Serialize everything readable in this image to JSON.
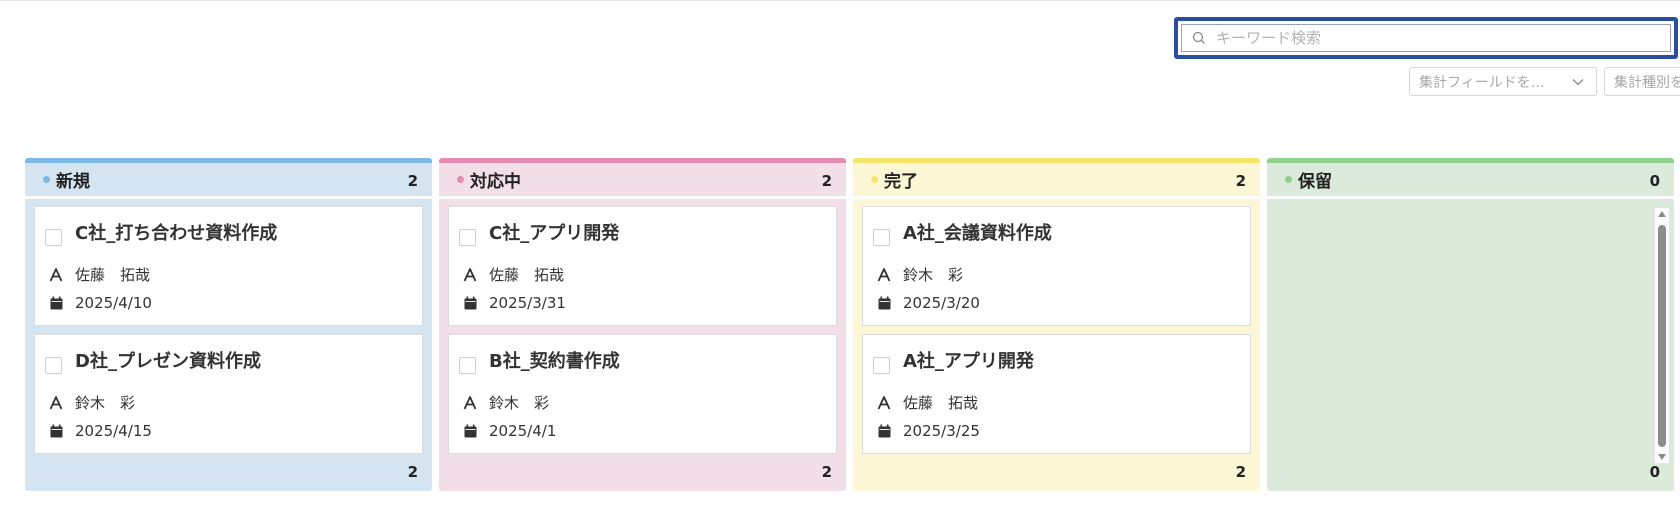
{
  "search": {
    "placeholder": "キーワード検索"
  },
  "aggregate": {
    "field_select": "集計フィールドを…",
    "type_select": "集計種別を"
  },
  "columns": [
    {
      "title": "新規",
      "count": "2",
      "footer_count": "2",
      "accent": "#7bb8e6",
      "header_bg": "#d4e4f0",
      "body_bg": "#d4e4f0",
      "cards": [
        {
          "title": "C社_打ち合わせ資料作成",
          "assignee": "佐藤　拓哉",
          "date": "2025/4/10"
        },
        {
          "title": "D社_プレゼン資料作成",
          "assignee": "鈴木　彩",
          "date": "2025/4/15"
        }
      ]
    },
    {
      "title": "対応中",
      "count": "2",
      "footer_count": "2",
      "accent": "#e58bb1",
      "header_bg": "#f3dfe7",
      "body_bg": "#f3dfe7",
      "cards": [
        {
          "title": "C社_アプリ開発",
          "assignee": "佐藤　拓哉",
          "date": "2025/3/31"
        },
        {
          "title": "B社_契約書作成",
          "assignee": "鈴木　彩",
          "date": "2025/4/1"
        }
      ]
    },
    {
      "title": "完了",
      "count": "2",
      "footer_count": "2",
      "accent": "#f5e56b",
      "header_bg": "#fdf7d6",
      "body_bg": "#fdf7d6",
      "cards": [
        {
          "title": "A社_会議資料作成",
          "assignee": "鈴木　彩",
          "date": "2025/3/20"
        },
        {
          "title": "A社_アプリ開発",
          "assignee": "佐藤　拓哉",
          "date": "2025/3/25"
        }
      ]
    },
    {
      "title": "保留",
      "count": "0",
      "footer_count": "0",
      "accent": "#8fd08c",
      "header_bg": "#dbeada",
      "body_bg": "#dbeada",
      "cards": []
    }
  ],
  "icons": {
    "search": "search-icon",
    "assignee": "person-a-icon",
    "date": "calendar-icon",
    "dropdown": "chevron-down-icon"
  }
}
